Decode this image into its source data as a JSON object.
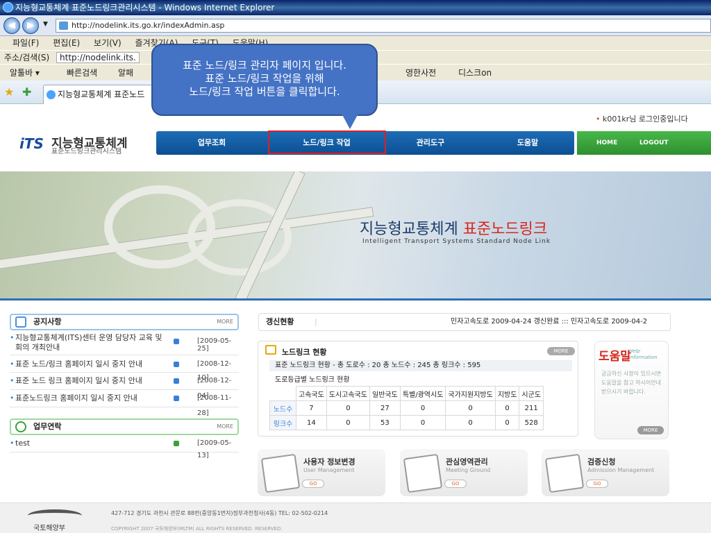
{
  "browser": {
    "title": "지능형교통체계 표준노드링크관리시스템 - Windows Internet Explorer",
    "address": "http://nodelink.its.go.kr/indexAdmin.asp",
    "menu": [
      "파일(F)",
      "편집(E)",
      "보기(V)",
      "즐겨찾기(A)",
      "도구(T)",
      "도움말(H)"
    ],
    "links_label": "주소/검색(S)",
    "links_address": "http://nodelink.its.",
    "toolbar": [
      "알툴바 ▾",
      "빠른검색",
      "알패",
      "영한사전",
      "디스크on"
    ],
    "tab_title": "지능형교통체계 표준노드"
  },
  "callout": {
    "line1": "표준 노드/링크 관리자 페이지 입니다.",
    "line2": "표준 노드/링크 작업을 위해",
    "line3": "노드/링크 작업 버튼을 클릭합니다."
  },
  "site": {
    "logo_mark": "iTS",
    "logo_title": "지능형교통체계",
    "logo_sub": "표준노드링크관리시스템",
    "login_status": "k001kr님 로그인중입니다",
    "gnb": [
      "업무조회",
      "노드/링크 작업",
      "관리도구",
      "도움말"
    ],
    "util": [
      "HOME",
      "LOGOUT"
    ],
    "banner_title_main": "지능형교통체계 ",
    "banner_title_red": "표준노드링크",
    "banner_sub": "Intelligent Transport Systems Standard Node Link"
  },
  "notices": {
    "title": "공지사항",
    "more": "MORE",
    "items": [
      {
        "title": "지능형교통체계(ITS)센터 운영 담당자 교육 및 회의 개최안내",
        "date": "[2009-05-25]"
      },
      {
        "title": "표준 노드/링크 홈페이지 일시 중지 안내",
        "date": "[2008-12-10]"
      },
      {
        "title": "표준 노드 링크 홈페이지 일시 중지 안내",
        "date": "[2008-12-04]"
      },
      {
        "title": "표준노드링크 홈페이지 일시 중지 안내",
        "date": "[2008-11-28]"
      }
    ]
  },
  "contacts": {
    "title": "업무연락",
    "more": "MORE",
    "items": [
      {
        "title": "test",
        "date": "[2009-05-13]"
      }
    ]
  },
  "update": {
    "label": "갱신현황",
    "text": "민자고속도로  2009-04-24  갱신완료   :::   민자고속도로  2009-04-2"
  },
  "nodelink": {
    "title": "노드링크 현황",
    "more": "MORE",
    "line1": "표준 노드링크 현황 - 총 도로수 : 20   총 노드수 : 245   총 링크수 : 595",
    "line2": "도로등급별 노드링크 현황",
    "headers": [
      "고속국도",
      "도시고속국도",
      "일반국도",
      "특별/광역시도",
      "국가지원지방도",
      "지방도",
      "시군도"
    ],
    "rows": [
      {
        "label": "노드수",
        "values": [
          "7",
          "0",
          "27",
          "0",
          "0",
          "0",
          "211"
        ]
      },
      {
        "label": "링크수",
        "values": [
          "14",
          "0",
          "53",
          "0",
          "0",
          "0",
          "528"
        ]
      }
    ]
  },
  "help": {
    "title": "도움말",
    "sub": "Help Information",
    "text": "궁금하신 사항이 있으시면 도움말을 참고 하시어안내 받으시기 바랍니다.",
    "more": "MORE"
  },
  "cards": [
    {
      "title": "사용자 정보변경",
      "sub": "User Management",
      "go": "GO"
    },
    {
      "title": "관심영역관리",
      "sub": "Meeting Ground",
      "go": "GO"
    },
    {
      "title": "검증신청",
      "sub": "Admission Management",
      "go": "GO"
    }
  ],
  "footer": {
    "logo_text": "국토해양부",
    "address": "427-712 경기도 과천시 관문로 88번(중앙동1번지)정부과천청사(4동)  TEL: 02-502-0214",
    "copyright": "COPYRIGHT  2007 국토해양부(MLTM) ALL RIGHTS RESERVED. RESERVED."
  }
}
